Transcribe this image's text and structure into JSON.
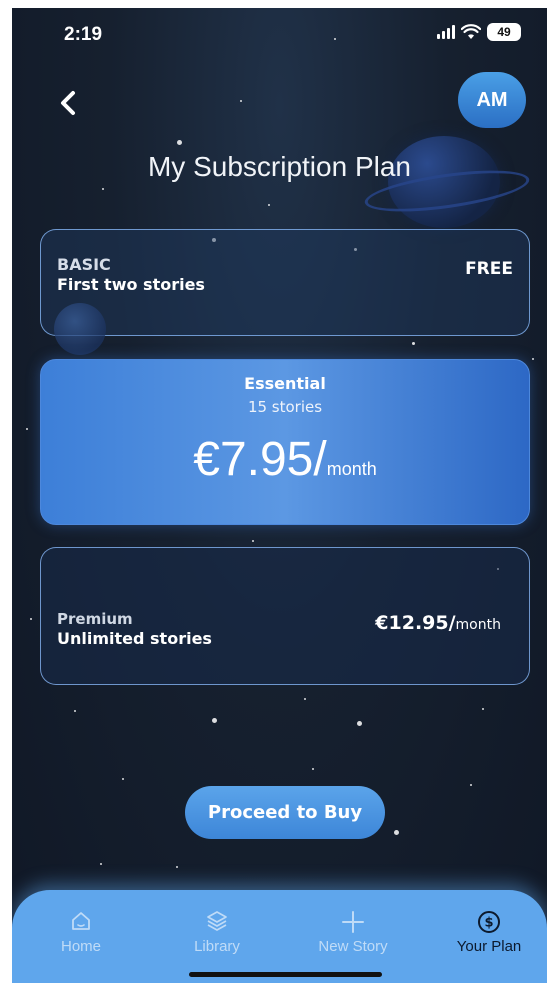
{
  "status_bar": {
    "time": "2:19",
    "battery": "49"
  },
  "header": {
    "avatar_initials": "AM",
    "title": "My Subscription Plan"
  },
  "plans": {
    "basic": {
      "name": "BASIC",
      "description": "First two stories",
      "price": "FREE"
    },
    "essential": {
      "name": "Essential",
      "description": "15 stories",
      "price": "€7.95/",
      "unit": "month",
      "selected": true
    },
    "premium": {
      "name": "Premium",
      "description": "Unlimited stories",
      "price": "€12.95/",
      "unit": "month"
    }
  },
  "buy_button": {
    "label": "Proceed to Buy"
  },
  "tabs": [
    {
      "label": "Home",
      "icon": "home-icon"
    },
    {
      "label": "Library",
      "icon": "layers-icon"
    },
    {
      "label": "New Story",
      "icon": "plus-icon"
    },
    {
      "label": "Your Plan",
      "icon": "dollar-icon",
      "active": true
    }
  ],
  "colors": {
    "accent": "#4a90e2",
    "tabbar": "#5fa6ec",
    "background": "#16202f"
  }
}
